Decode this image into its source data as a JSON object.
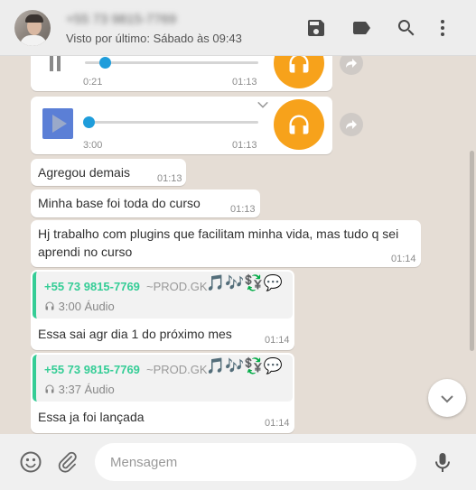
{
  "header": {
    "contact_name": "+55 73 9815-7769",
    "last_seen": "Visto por último: Sábado às 09:43",
    "icons": [
      "save-icon",
      "label-icon",
      "search-icon",
      "menu-icon"
    ]
  },
  "chat": {
    "audio_messages": [
      {
        "elapsed": "0:21",
        "time": "01:13",
        "state": "playing",
        "progress": 0.1
      },
      {
        "elapsed": "3:00",
        "time": "01:13",
        "state": "paused",
        "progress": 0.0
      }
    ],
    "messages": [
      {
        "text": "Agregou demais",
        "time": "01:13"
      },
      {
        "text": "Minha base foi toda do curso",
        "time": "01:13"
      },
      {
        "line1": "Hj trabalho com plugins que facilitam minha vida, mas tudo q sei",
        "line2": "aprendi no curso",
        "time": "01:14"
      }
    ],
    "replies": [
      {
        "sender": "+55 73 9815-7769",
        "alias": "~PROD.GK",
        "emoji": "🎵🎶💱💬",
        "audio": "3:00 Áudio",
        "text": "Essa sai agr dia 1 do próximo mes",
        "time": "01:14"
      },
      {
        "sender": "+55 73 9815-7769",
        "alias": "~PROD.GK",
        "emoji": "🎵🎶💱💬",
        "audio": "3:37 Áudio",
        "text": "Essa ja foi lançada",
        "time": "01:14"
      }
    ]
  },
  "footer": {
    "placeholder": "Mensagem"
  },
  "colors": {
    "accent_green": "#35cd96",
    "headset_orange": "#f7a21b",
    "audio_blue": "#1f9ddb"
  }
}
